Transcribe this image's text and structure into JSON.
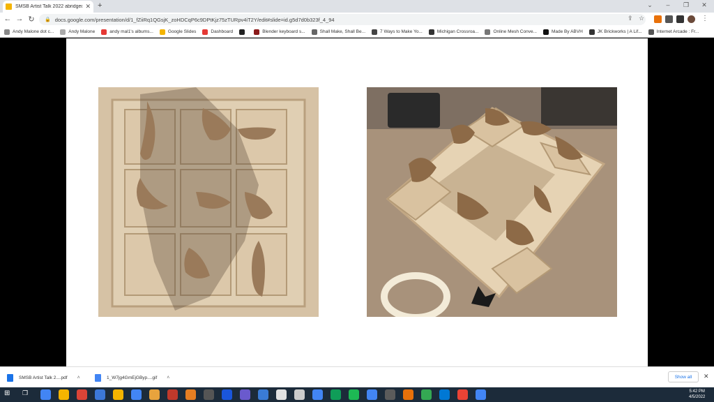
{
  "browser": {
    "tab_title": "SMSB Artist Talk 2022 abridged",
    "new_tab_icon": "plus-icon",
    "url": "docs.google.com/presentation/d/1_fZiiRq1QGsjK_zoHDCqP6c9DPtKjz75zTURpv4iT2Y/edit#slide=id.g5d7d0b323f_4_94"
  },
  "bookmarks": [
    {
      "label": "Andy Malone dot c...",
      "color": "#888888"
    },
    {
      "label": "Andy Malone",
      "color": "#aaaaaa"
    },
    {
      "label": "andy mal1's albums...",
      "color": "#e53935"
    },
    {
      "label": "Google Slides",
      "color": "#f4b400"
    },
    {
      "label": "Dashboard",
      "color": "#e53935"
    },
    {
      "label": "",
      "color": "#222222"
    },
    {
      "label": "Blender keyboard s...",
      "color": "#8b1a1a"
    },
    {
      "label": "Shall Make, Shall Be...",
      "color": "#666666"
    },
    {
      "label": "7 Ways to Make Yo...",
      "color": "#444444"
    },
    {
      "label": "Michigan Crossroa...",
      "color": "#333333"
    },
    {
      "label": "Online Mesh Conve...",
      "color": "#777777"
    },
    {
      "label": "Made By ABVH",
      "color": "#111111"
    },
    {
      "label": "JK Brickworks | A Lif...",
      "color": "#333333"
    },
    {
      "label": "Internet Arcade : Fr...",
      "color": "#555555"
    }
  ],
  "downloads": [
    {
      "name": "SMSB Artist Talk 2....pdf",
      "color": "#1a73e8"
    },
    {
      "name": "1_W7jg4GmEjGByp....gif",
      "color": "#4285f4"
    }
  ],
  "downloads_show_all": "Show all",
  "clock": {
    "time": "5:42 PM",
    "date": "4/5/2022"
  },
  "colors": {
    "accent": "#1a73e8",
    "taskbar": "#1c2b3a"
  }
}
